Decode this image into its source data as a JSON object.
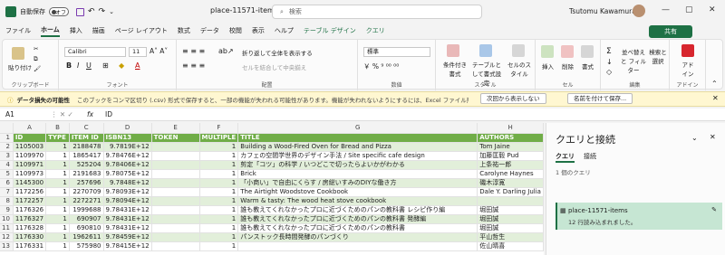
{
  "titlebar": {
    "autosave_label": "自動保存",
    "toggle_state": "オフ",
    "filename": "place-11571-items.csv",
    "search_placeholder": "検索",
    "user_name": "Tsutomu Kawamura"
  },
  "menu": {
    "items": [
      "ファイル",
      "ホーム",
      "挿入",
      "描画",
      "ページ レイアウト",
      "数式",
      "データ",
      "校閲",
      "表示",
      "ヘルプ",
      "テーブル デザイン",
      "クエリ"
    ],
    "active_index": 1,
    "share_label": "共有"
  },
  "ribbon": {
    "clipboard": {
      "paste": "貼り付け",
      "label": "クリップボード"
    },
    "font": {
      "name": "Calibri",
      "size": "11",
      "label": "フォント"
    },
    "alignment": {
      "wrap": "折り返して全体を表示する",
      "merge": "セルを結合して中央揃え",
      "label": "配置"
    },
    "number": {
      "format": "標準",
      "label": "数値"
    },
    "styles": {
      "conditional": "条件付き書式",
      "table": "テーブルとして書式設定",
      "cell": "セルのスタイル",
      "label": "スタイル"
    },
    "cells": {
      "insert": "挿入",
      "delete": "削除",
      "format": "書式",
      "label": "セル"
    },
    "editing": {
      "sort": "並べ替えと フィルター",
      "find": "検索と選択",
      "label": "編集"
    },
    "addins": {
      "button": "アド イン",
      "label": "アドイン"
    }
  },
  "infobar": {
    "title": "データ損失の可能性",
    "message": "このブックをコンマ区切り (.csv) 形式で保存すると、一部の機能が失われる可能性があります。機能が失われないようにするには、Excel ファイル形式で保存してください。",
    "btn_dismiss": "次回から表示しない",
    "btn_saveas": "名前を付けて保存..."
  },
  "formula_bar": {
    "cell_ref": "A1",
    "fx": "fx",
    "value": "ID"
  },
  "grid": {
    "col_letters": [
      "A",
      "B",
      "C",
      "D",
      "E",
      "F",
      "G",
      "H"
    ],
    "headers": [
      "ID",
      "TYPE",
      "ITEM ID",
      "ISBN13",
      "TOKEN",
      "MULTIPLE",
      "TITLE",
      "AUTHORS"
    ],
    "rows": [
      [
        "1105003",
        "1",
        "2188478",
        "9.7819E+12",
        "",
        "1",
        "Building a Wood-Fired Oven for Bread and Pizza",
        "Tom Jaine"
      ],
      [
        "1109970",
        "1",
        "1865417",
        "9.78476E+12",
        "",
        "1",
        "カフェの空間学世界のデザイン手法 / Site specific cafe design",
        "加藤匡毅 Pud"
      ],
      [
        "1109971",
        "1",
        "525204",
        "9.78406E+12",
        "",
        "1",
        "剪定「コツ」の科学 / いつどこで切ったらよいかがわかる",
        "上条祐一郎"
      ],
      [
        "1109973",
        "1",
        "2191683",
        "9.78075E+12",
        "",
        "1",
        "Brick",
        "Carolyne Haynes"
      ],
      [
        "1145300",
        "1",
        "257696",
        "9.7848E+12",
        "",
        "1",
        "「小商い」で自由にくらす / 房総いすみのDIYな働き方",
        "磯木淳寛"
      ],
      [
        "1172256",
        "1",
        "2270709",
        "9.78093E+12",
        "",
        "1",
        "The Airtight Woodstove Cookbook",
        "Dale Y. Darling Julia"
      ],
      [
        "1172257",
        "1",
        "2272271",
        "9.78094E+12",
        "",
        "1",
        "Warm & tasty: The wood heat stove cookbook",
        ""
      ],
      [
        "1176326",
        "1",
        "1999688",
        "9.78431E+12",
        "",
        "1",
        "誰も教えてくれなかったプロに近づくためのパンの教科書 レシピ作り編",
        "堀田誠"
      ],
      [
        "1176327",
        "1",
        "690907",
        "9.78431E+12",
        "",
        "1",
        "誰も教えてくれなかったプロに近づくためのパンの教科書 発酵編",
        "堀田誠"
      ],
      [
        "1176328",
        "1",
        "690810",
        "9.78431E+12",
        "",
        "1",
        "誰も教えてくれなかったプロに近づくためのパンの教科書",
        "堀田誠"
      ],
      [
        "1176330",
        "1",
        "1962611",
        "9.78459E+12",
        "",
        "1",
        "パンストック長時間発酵のパンづくり",
        "平山哲生"
      ],
      [
        "1176331",
        "1",
        "575980",
        "9.78415E+12",
        "",
        "1",
        "",
        "佐山晴喜"
      ]
    ]
  },
  "pane": {
    "title": "クエリと接続",
    "tab_queries": "クエリ",
    "tab_connections": "接続",
    "count": "1 個のクエリ",
    "query_name": "place-11571-items",
    "query_status": "12 行読み込まれました。"
  }
}
